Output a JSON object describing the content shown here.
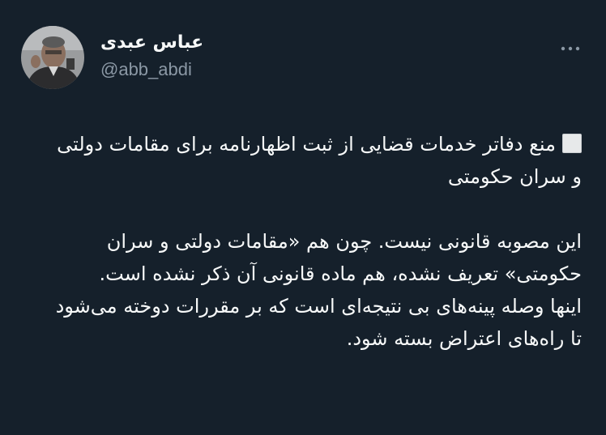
{
  "author": {
    "display_name": "عباس عبدی",
    "handle": "@abb_abdi"
  },
  "icons": {
    "more": "more-dots-icon",
    "bullet": "white-square-icon",
    "avatar": "profile-photo"
  },
  "tweet": {
    "headline": "منع دفاتر خدمات قضایی از ثبت اظهارنامه برای مقامات دولتی و سران حکومتی",
    "paragraph1": "این  مصوبه قانونی نیست. چون هم «مقامات دولتی و سران حکومتی» تعریف نشده، هم ماده قانونی آن ذکر نشده است.",
    "paragraph2": "اینها وصله پینه‌های بی نتیجه‌ای است که بر مقررات دوخته می‌شود تا راه‌های اعتراض بسته شود."
  },
  "colors": {
    "background": "#15202b",
    "text": "#f7f9f9",
    "secondary": "#8b98a5"
  }
}
